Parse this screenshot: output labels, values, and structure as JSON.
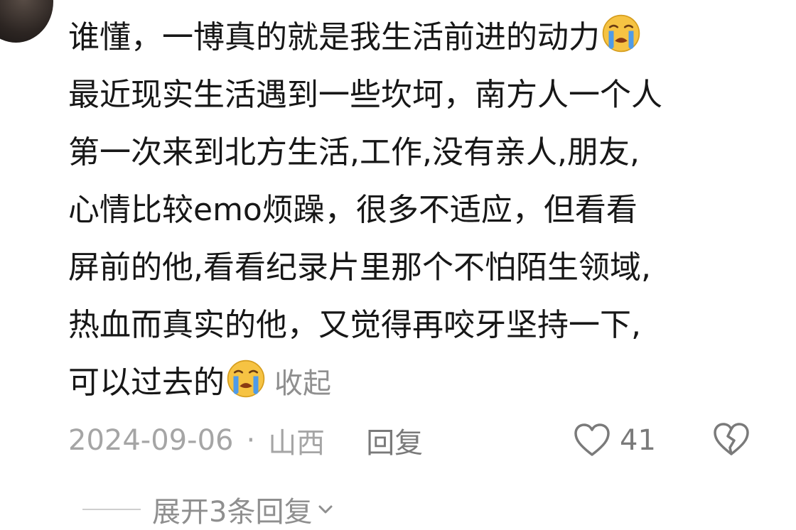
{
  "comment": {
    "lines": [
      "谁懂，一博真的就是我生活前进的动力",
      "最近现实生活遇到一些坎坷，南方人一个人",
      "第一次来到北方生活,工作,没有亲人,朋友,",
      "心情比较emo烦躁，很多不适应，但看看",
      "屏前的他,看看纪录片里那个不怕陌生领域,",
      "热血而真实的他，又觉得再咬牙坚持一下,",
      "可以过去的"
    ],
    "emoji": "crying-face-emoji",
    "collapse_label": "收起"
  },
  "meta": {
    "date": "2024-09-06",
    "dot": "·",
    "location": "山西",
    "reply_label": "回复"
  },
  "actions": {
    "like_count": "41",
    "like_icon": "heart-outline-icon",
    "dislike_icon": "broken-heart-icon"
  },
  "replies": {
    "expand_label": "展开3条回复",
    "chevron_icon": "chevron-down-icon"
  },
  "colors": {
    "text_primary": "#171717",
    "text_secondary": "#8f8f8f",
    "emoji_face": "#f5c542",
    "emoji_tears": "#4f9be8"
  }
}
